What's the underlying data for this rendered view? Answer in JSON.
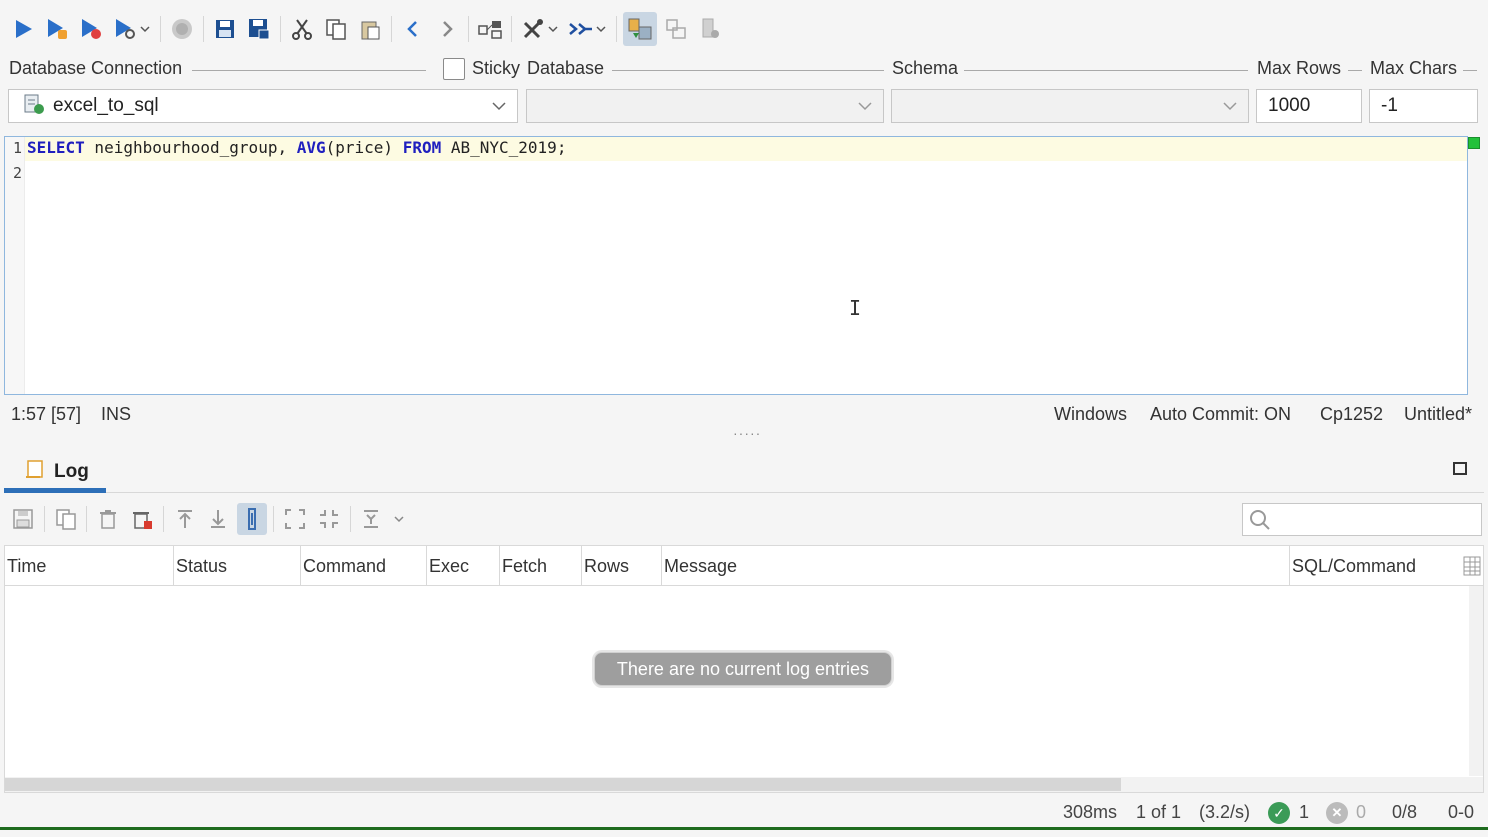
{
  "toolbar": {
    "icons": [
      "execute-icon",
      "execute-selection-icon",
      "execute-script-icon",
      "explain-icon",
      "stop-icon",
      "save-icon",
      "save-as-icon",
      "cut-icon",
      "copy-icon",
      "paste-icon",
      "back-icon",
      "forward-icon",
      "query-builder-icon",
      "tools-icon",
      "format-icon",
      "editor-to-results-icon",
      "results-tab-icon",
      "results-panel-icon"
    ]
  },
  "connection": {
    "label": "Database Connection",
    "value": "excel_to_sql"
  },
  "sticky": {
    "label": "Sticky",
    "checked": false
  },
  "database": {
    "label": "Database",
    "value": ""
  },
  "schema": {
    "label": "Schema",
    "value": ""
  },
  "max_rows": {
    "label": "Max Rows",
    "value": "1000"
  },
  "max_chars": {
    "label": "Max Chars",
    "value": "-1"
  },
  "editor": {
    "line_numbers": [
      "1",
      "2"
    ],
    "sql": {
      "kw_select": "SELECT",
      "text1": " neighbourhood_group, ",
      "fn_avg": "AVG",
      "text2": "(price) ",
      "kw_from": "FROM",
      "text3": " AB_NYC_2019;"
    }
  },
  "status": {
    "position": "1:57 [57]",
    "mode": "INS",
    "line_ending": "Windows",
    "auto_commit": "Auto Commit: ON",
    "encoding": "Cp1252",
    "file": "Untitled*"
  },
  "log": {
    "tab_label": "Log",
    "search_placeholder": "",
    "columns": [
      "Time",
      "Status",
      "Command",
      "Exec",
      "Fetch",
      "Rows",
      "Message",
      "SQL/Command"
    ],
    "empty_message": "There are no current log entries"
  },
  "bottom_status": {
    "elapsed": "308ms",
    "result_position": "1 of 1",
    "rate": "(3.2/s)",
    "success_count": "1",
    "error_count": "0",
    "rows_fraction": "0/8",
    "range": "0-0"
  },
  "colors": {
    "accent": "#2d6fb8",
    "keyword": "#1f1fbf",
    "success": "#3b9b57"
  }
}
